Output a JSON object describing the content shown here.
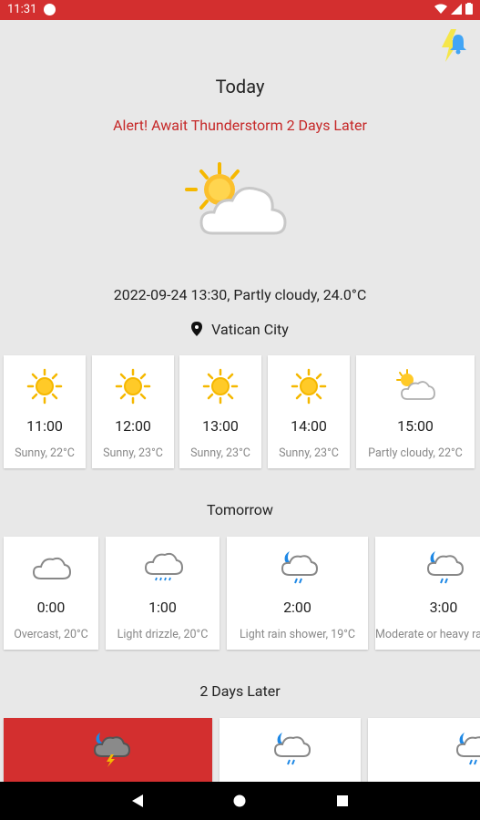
{
  "status_bar": {
    "time": "11:31"
  },
  "header": {
    "today": "Today",
    "alert": "Alert! Await Thunderstorm 2 Days Later"
  },
  "current": {
    "summary": "2022-09-24 13:30, Partly cloudy, 24.0°C",
    "location": "Vatican City"
  },
  "today_hours": [
    {
      "time": "11:00",
      "desc": "Sunny, 22°C",
      "icon": "sun-icon"
    },
    {
      "time": "12:00",
      "desc": "Sunny, 23°C",
      "icon": "sun-icon"
    },
    {
      "time": "13:00",
      "desc": "Sunny, 23°C",
      "icon": "sun-icon"
    },
    {
      "time": "14:00",
      "desc": "Sunny, 23°C",
      "icon": "sun-icon"
    },
    {
      "time": "15:00",
      "desc": "Partly cloudy, 22°C",
      "icon": "partly-cloudy-icon"
    }
  ],
  "tomorrow": {
    "title": "Tomorrow",
    "hours": [
      {
        "time": "0:00",
        "desc": "Overcast, 20°C",
        "icon": "cloud-icon"
      },
      {
        "time": "1:00",
        "desc": "Light drizzle, 20°C",
        "icon": "drizzle-icon"
      },
      {
        "time": "2:00",
        "desc": "Light rain shower, 19°C",
        "icon": "night-rain-icon"
      },
      {
        "time": "3:00",
        "desc": "Moderate or heavy rain shower",
        "icon": "night-rain-icon"
      }
    ]
  },
  "two_days": {
    "title": "2 Days Later"
  },
  "colors": {
    "accent": "#d32f2f",
    "alert_text": "#c62828",
    "background": "#e8e8e8"
  }
}
